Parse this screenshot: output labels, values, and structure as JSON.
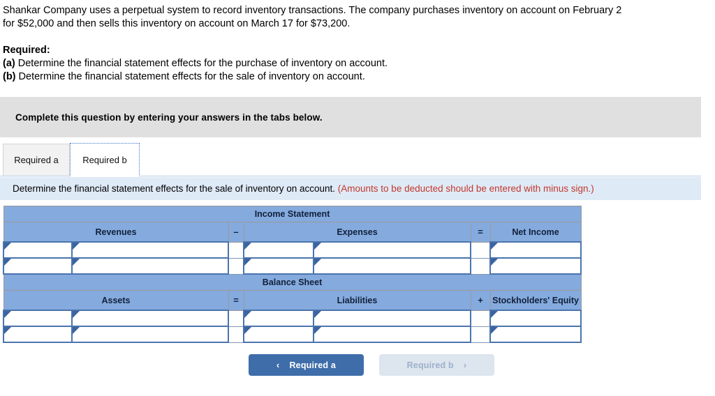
{
  "problem": {
    "paragraph": "Shankar Company uses a perpetual system to record inventory transactions. The company purchases inventory on account on February 2 for $52,000 and then sells this inventory on account on March 17 for $73,200.",
    "required_heading": "Required:",
    "requirements": [
      {
        "marker": "(a)",
        "text": " Determine the financial statement effects for the purchase of inventory on account."
      },
      {
        "marker": "(b)",
        "text": " Determine the financial statement effects for the sale of inventory on account."
      }
    ]
  },
  "banner": {
    "text": "Complete this question by entering your answers in the tabs below."
  },
  "tabs": [
    {
      "label": "Required a",
      "active": false
    },
    {
      "label": "Required b",
      "active": true
    }
  ],
  "instruction": {
    "text": "Determine the financial statement effects for the sale of inventory on account.",
    "note": "(Amounts to be deducted should be entered with minus sign.)"
  },
  "table": {
    "income_statement": {
      "section_title": "Income Statement",
      "columns": [
        "Revenues",
        "Expenses",
        "Net Income"
      ],
      "operators": {
        "first": "–",
        "second": "="
      },
      "rows": [
        {
          "revenue_label": "",
          "revenue_amount": "",
          "expense_label": "",
          "expense_amount": "",
          "net_income": ""
        },
        {
          "revenue_label": "",
          "revenue_amount": "",
          "expense_label": "",
          "expense_amount": "",
          "net_income": ""
        }
      ]
    },
    "balance_sheet": {
      "section_title": "Balance Sheet",
      "columns": [
        "Assets",
        "Liabilities",
        "Stockholders' Equity"
      ],
      "operators": {
        "first": "=",
        "second": "+"
      },
      "rows": [
        {
          "asset_label": "",
          "asset_amount": "",
          "liability_label": "",
          "liability_amount": "",
          "equity": ""
        },
        {
          "asset_label": "",
          "asset_amount": "",
          "liability_label": "",
          "liability_amount": "",
          "equity": ""
        }
      ]
    }
  },
  "navigation": {
    "prev": {
      "label": "Required a",
      "icon": "chevron-left-icon",
      "glyph": "‹",
      "enabled": true
    },
    "next": {
      "label": "Required b",
      "icon": "chevron-right-icon",
      "glyph": "›",
      "enabled": false
    }
  },
  "colors": {
    "header_blue": "#85aade",
    "instruction_blue": "#dfeaf7",
    "banner_gray": "#e0e0e0",
    "note_red": "#c0392b",
    "button_blue": "#3e6daa",
    "button_disabled": "#dde5ef"
  }
}
